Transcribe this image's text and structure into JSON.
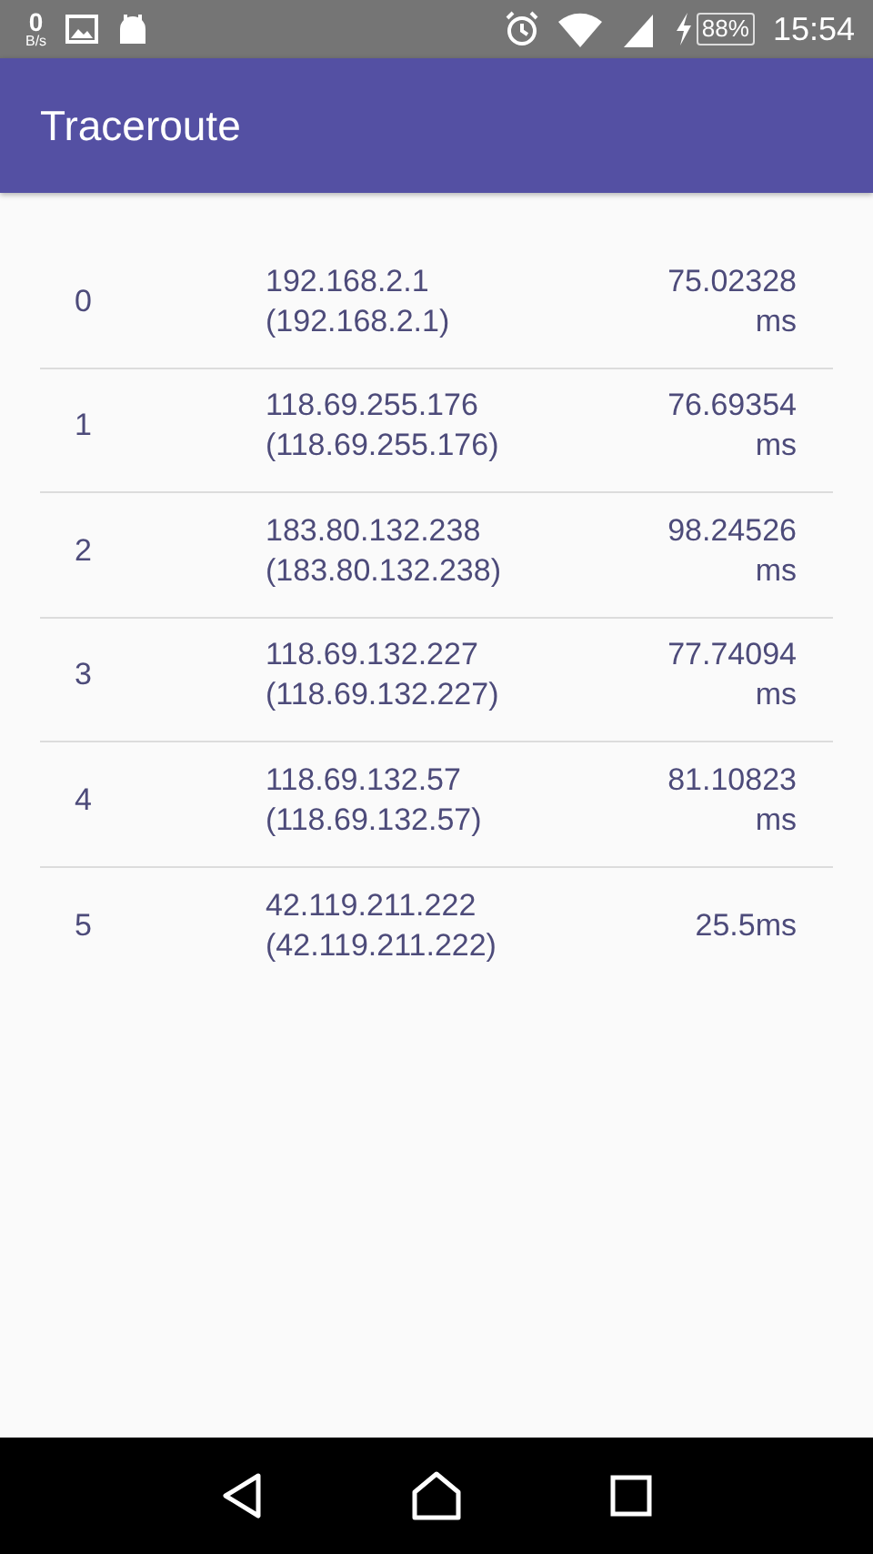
{
  "status_bar": {
    "speed_value": "0",
    "speed_unit": "B/s",
    "battery": "88%",
    "time": "15:54"
  },
  "app_bar": {
    "title": "Traceroute"
  },
  "hops": [
    {
      "hop": "0",
      "host": "192.168.2.1",
      "address": "(192.168.2.1)",
      "time": "75.02328",
      "unit": "ms"
    },
    {
      "hop": "1",
      "host": "118.69.255.176",
      "address": "(118.69.255.176)",
      "time": "76.69354",
      "unit": "ms"
    },
    {
      "hop": "2",
      "host": "183.80.132.238",
      "address": "(183.80.132.238)",
      "time": "98.24526",
      "unit": "ms"
    },
    {
      "hop": "3",
      "host": "118.69.132.227",
      "address": "(118.69.132.227)",
      "time": "77.74094",
      "unit": "ms"
    },
    {
      "hop": "4",
      "host": "118.69.132.57",
      "address": "(118.69.132.57)",
      "time": "81.10823",
      "unit": "ms"
    },
    {
      "hop": "5",
      "host": "42.119.211.222",
      "address": "(42.119.211.222)",
      "time": "25.5ms"
    }
  ]
}
